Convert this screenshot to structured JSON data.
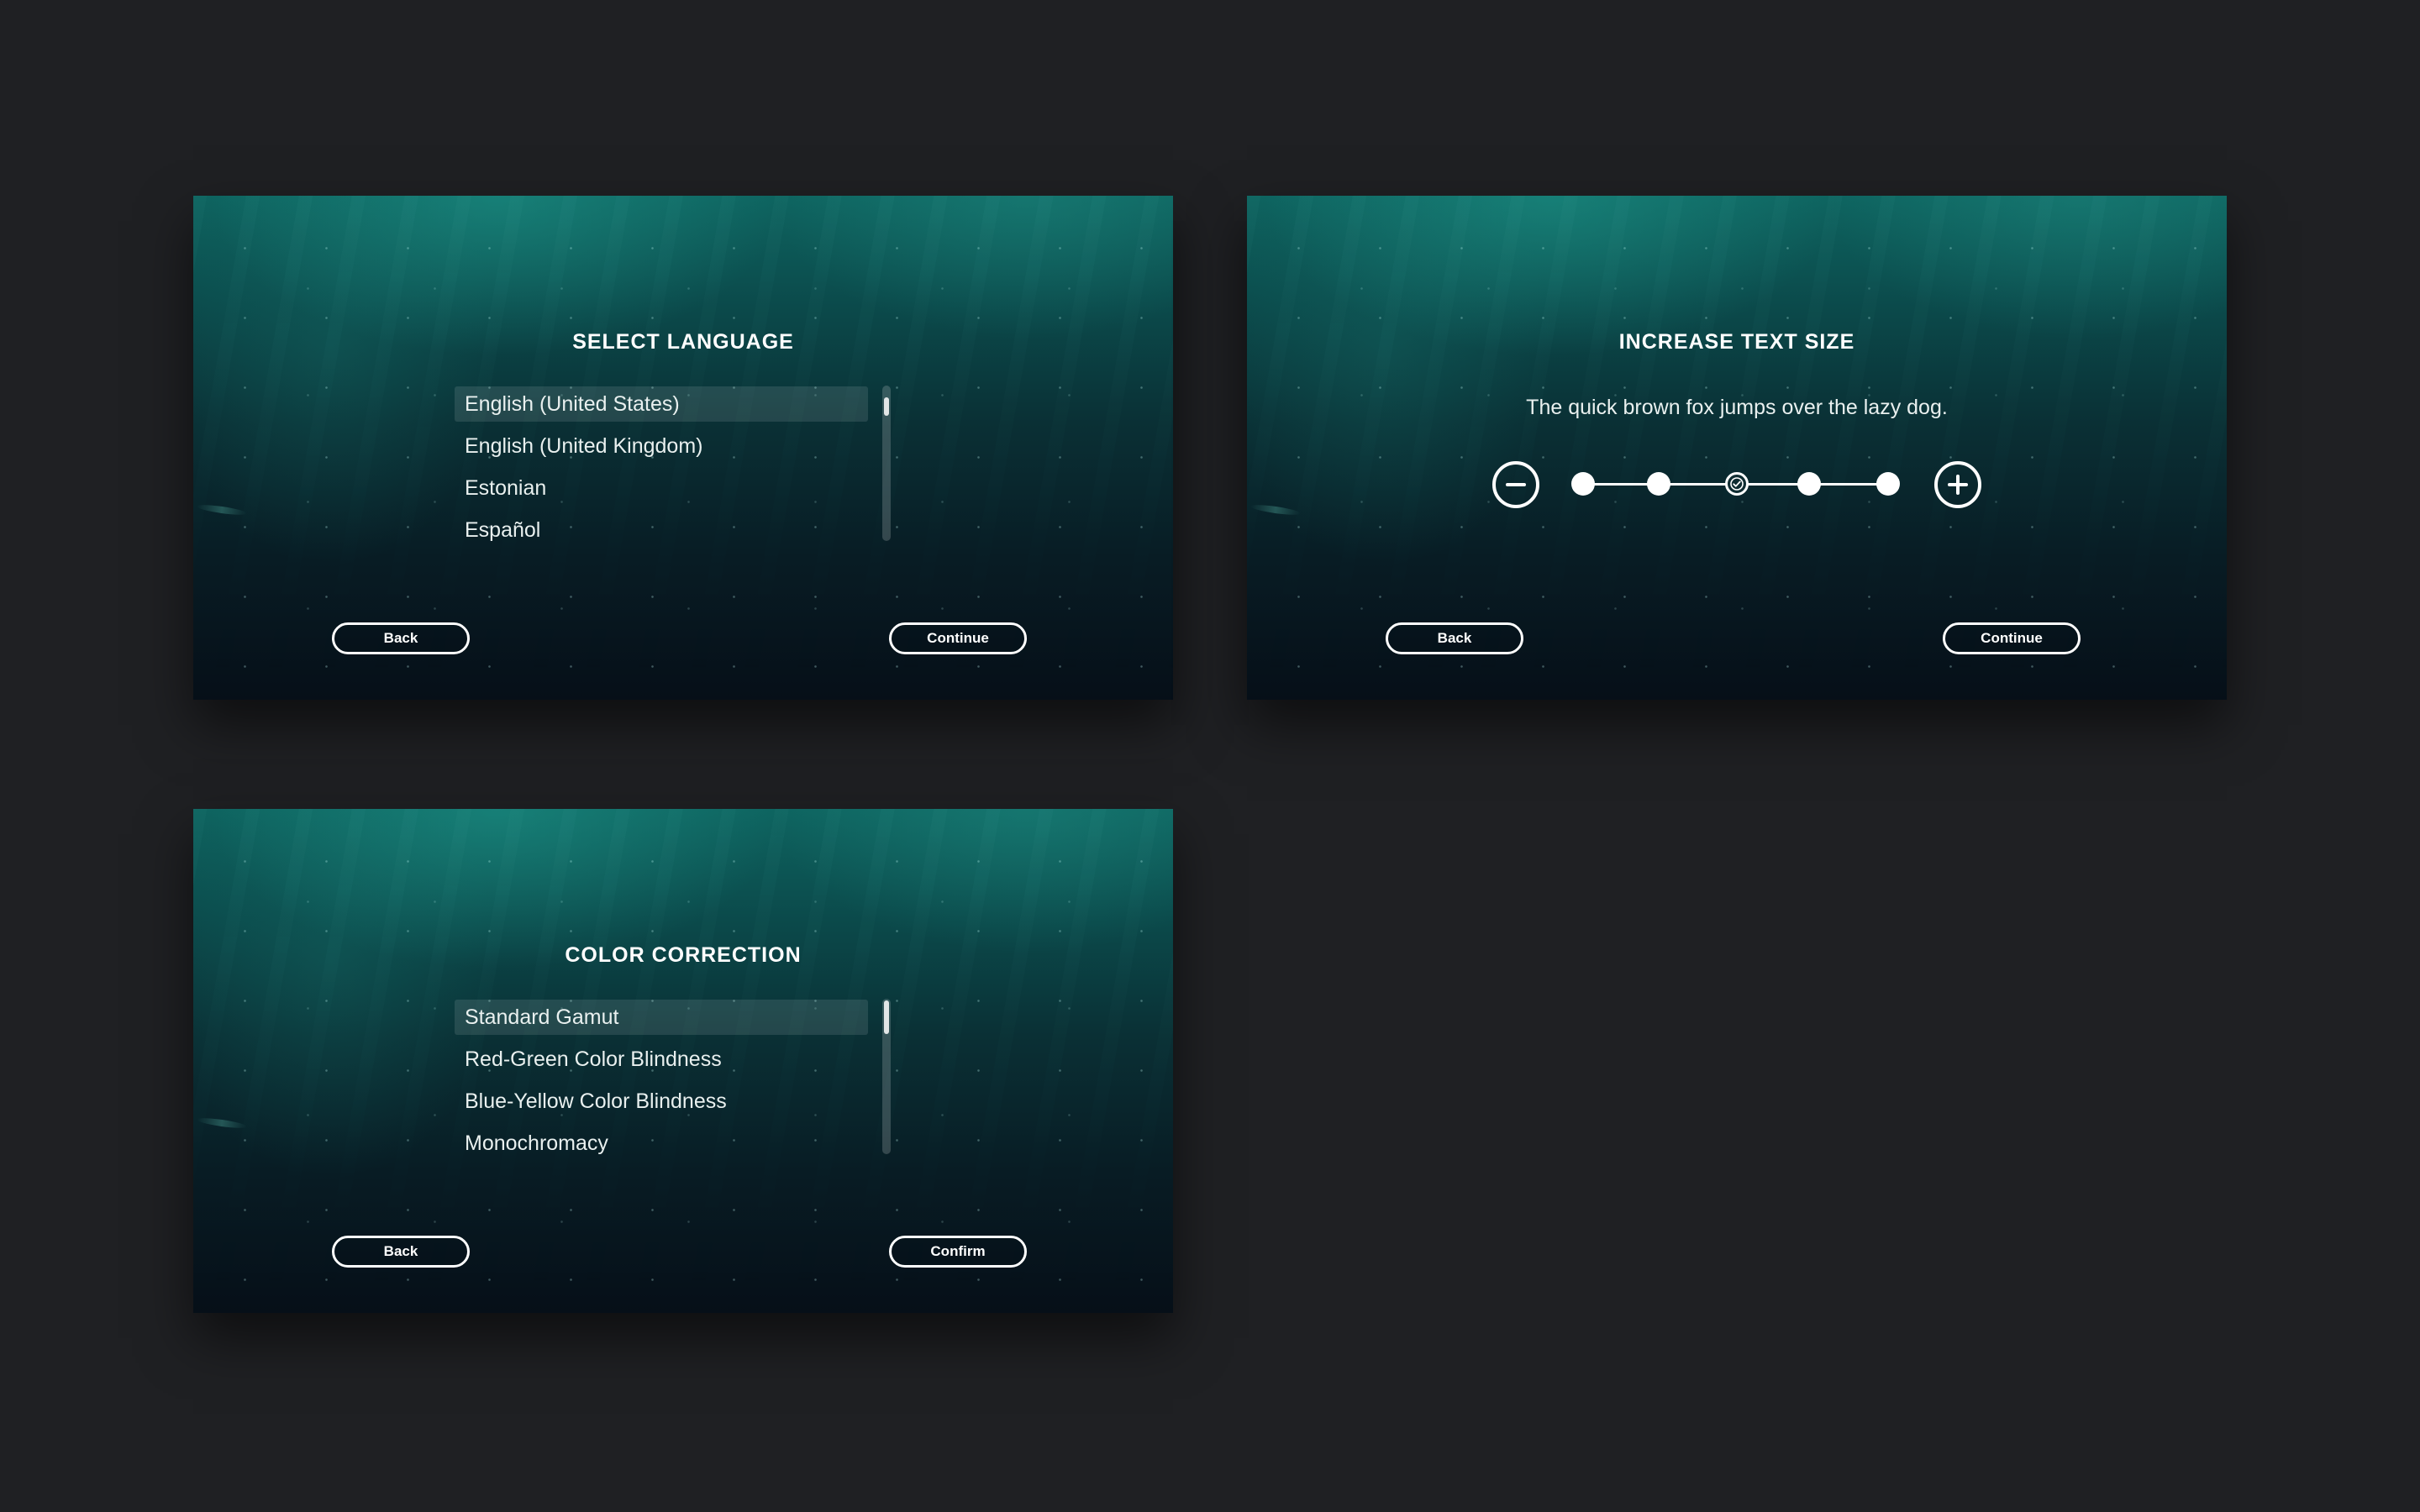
{
  "screens": {
    "language": {
      "title": "SELECT LANGUAGE",
      "items": [
        {
          "label": "English (United States)",
          "selected": true
        },
        {
          "label": "English (United Kingdom)",
          "selected": false
        },
        {
          "label": "Estonian",
          "selected": false
        },
        {
          "label": "Español",
          "selected": false
        }
      ],
      "back_label": "Back",
      "continue_label": "Continue"
    },
    "text_size": {
      "title": "INCREASE TEXT SIZE",
      "sample_text": "The quick brown fox jumps over the lazy dog.",
      "levels": 5,
      "current_level": 3,
      "decrease_icon": "minus-circle-icon",
      "increase_icon": "plus-circle-icon",
      "back_label": "Back",
      "continue_label": "Continue"
    },
    "color_correction": {
      "title": "COLOR CORRECTION",
      "items": [
        {
          "label": "Standard Gamut",
          "selected": true
        },
        {
          "label": "Red-Green Color Blindness",
          "selected": false
        },
        {
          "label": "Blue-Yellow Color Blindness",
          "selected": false
        },
        {
          "label": "Monochromacy",
          "selected": false
        }
      ],
      "back_label": "Back",
      "confirm_label": "Confirm"
    }
  },
  "colors": {
    "background": "#1f2023",
    "panel_top": "#0e6460",
    "panel_bottom": "#060f18",
    "foreground": "#ffffff"
  }
}
